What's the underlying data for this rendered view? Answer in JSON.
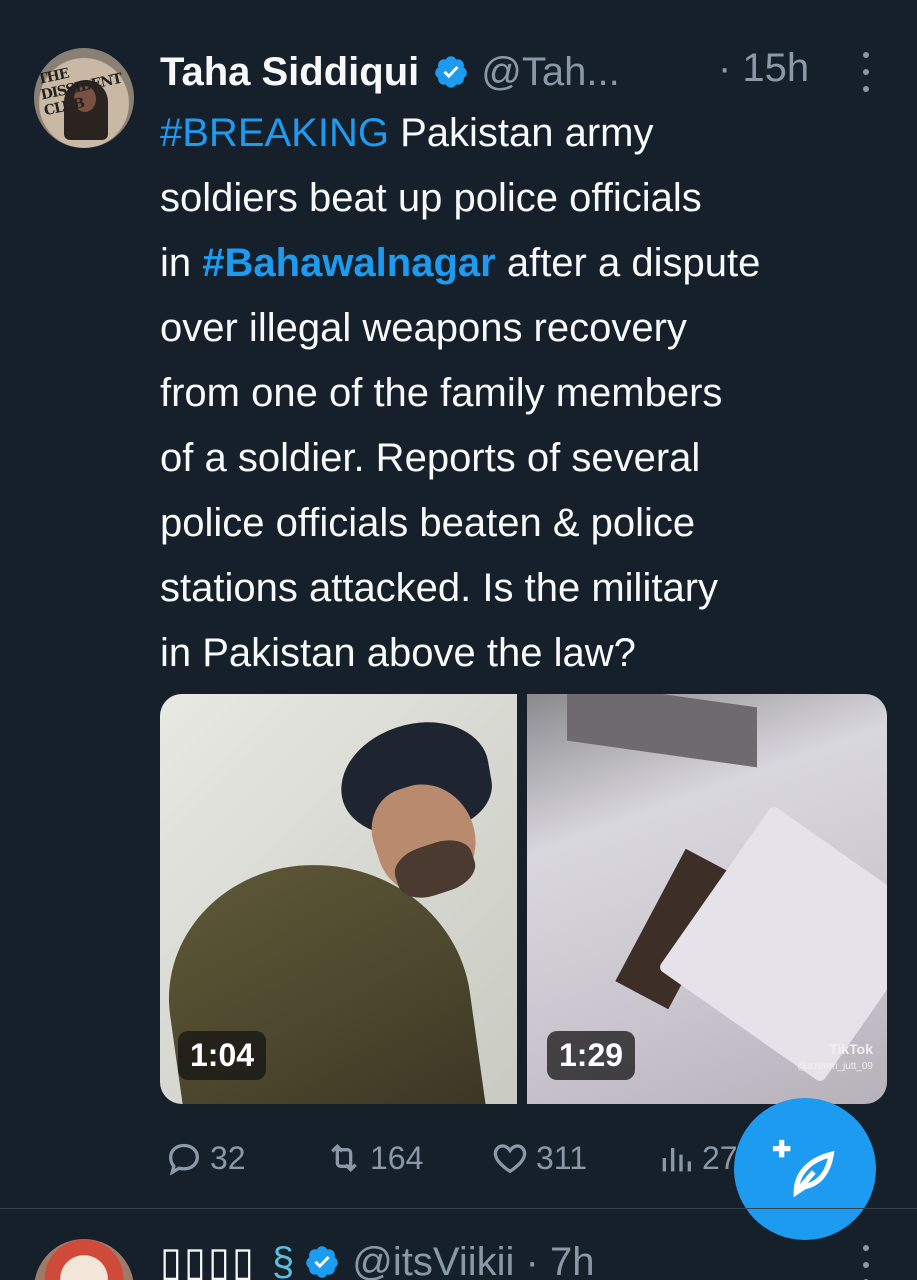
{
  "tweet": {
    "author_name": "Taha Siddiqui",
    "handle": "@Tah...",
    "time": "· 15h",
    "avatar_text": "THE DISSIDENT CLUB",
    "lines": [
      [
        {
          "t": "#BREAKING",
          "type": "hashtag"
        },
        {
          "t": " Pakistan army",
          "type": "text"
        }
      ],
      [
        {
          "t": "soldiers beat up police officials",
          "type": "text"
        }
      ],
      [
        {
          "t": "in ",
          "type": "text"
        },
        {
          "t": "#Bahawalnagar",
          "type": "hashtag-bold"
        },
        {
          "t": " after a dispute",
          "type": "text"
        }
      ],
      [
        {
          "t": "over illegal weapons recovery",
          "type": "text"
        }
      ],
      [
        {
          "t": "from one of the family members",
          "type": "text"
        }
      ],
      [
        {
          "t": "of a soldier. Reports of several",
          "type": "text"
        }
      ],
      [
        {
          "t": "police officials beaten & police",
          "type": "text"
        }
      ],
      [
        {
          "t": "stations attacked. Is the military",
          "type": "text"
        }
      ],
      [
        {
          "t": "in Pakistan above the law?",
          "type": "text"
        }
      ]
    ],
    "media": [
      {
        "duration": "1:04"
      },
      {
        "duration": "1:29",
        "watermark": "TikTok",
        "watermark_user": "@azeem_jutt_09"
      }
    ],
    "actions": {
      "replies": "32",
      "retweets": "164",
      "likes": "311",
      "views": "27"
    }
  },
  "next_tweet": {
    "author_name": "▯▯▯▯",
    "emoji": "§",
    "handle": "@itsViikii · 7h"
  },
  "colors": {
    "background": "#15202b",
    "accent": "#1d9bf0",
    "secondary_text": "#8b98a5"
  },
  "icons": [
    "more-icon",
    "verified-icon",
    "reply-icon",
    "retweet-icon",
    "like-icon",
    "views-icon",
    "compose-icon"
  ]
}
